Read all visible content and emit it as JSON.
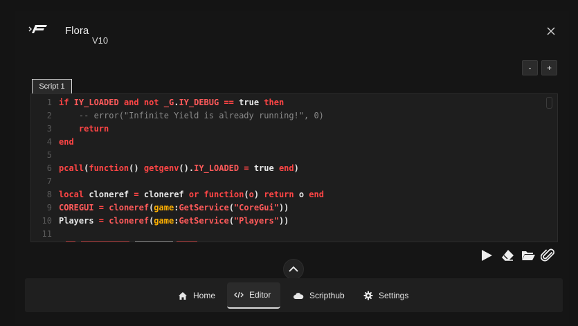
{
  "app": {
    "title": "Flora",
    "version": "V10"
  },
  "zoom": {
    "minus_label": "-",
    "plus_label": "+"
  },
  "editor": {
    "tabs": [
      {
        "label": "Script 1"
      }
    ],
    "lines": [
      {
        "n": "1",
        "tokens": [
          [
            "kw",
            "if "
          ],
          [
            "tk",
            "IY_LOADED"
          ],
          [
            "kw",
            " and not "
          ],
          [
            "tk",
            "_G"
          ],
          [
            "pl",
            "."
          ],
          [
            "tk",
            "IY_DEBUG"
          ],
          [
            "kw",
            " == "
          ],
          [
            "pl",
            "true"
          ],
          [
            "kw",
            " then"
          ]
        ]
      },
      {
        "n": "2",
        "tokens": [
          [
            "cm",
            "    -- error(\"Infinite Yield is already running!\", 0)"
          ]
        ]
      },
      {
        "n": "3",
        "tokens": [
          [
            "kw",
            "    return"
          ]
        ]
      },
      {
        "n": "4",
        "tokens": [
          [
            "kw",
            "end"
          ]
        ]
      },
      {
        "n": "5",
        "tokens": []
      },
      {
        "n": "6",
        "tokens": [
          [
            "kw",
            "pcall"
          ],
          [
            "pl",
            "("
          ],
          [
            "kw",
            "function"
          ],
          [
            "pl",
            "() "
          ],
          [
            "kw",
            "getgenv"
          ],
          [
            "pl",
            "()."
          ],
          [
            "tk",
            "IY_LOADED"
          ],
          [
            "kw",
            " = "
          ],
          [
            "pl",
            "true"
          ],
          [
            "kw",
            " end"
          ],
          [
            "pl",
            ")"
          ]
        ]
      },
      {
        "n": "7",
        "tokens": []
      },
      {
        "n": "8",
        "tokens": [
          [
            "kw",
            "local "
          ],
          [
            "pl",
            "cloneref"
          ],
          [
            "kw",
            " = "
          ],
          [
            "pl",
            "cloneref"
          ],
          [
            "kw",
            " or function"
          ],
          [
            "pl",
            "("
          ],
          [
            "tk",
            "o"
          ],
          [
            "pl",
            ") "
          ],
          [
            "kw",
            "return "
          ],
          [
            "pl",
            "o"
          ],
          [
            "kw",
            " end"
          ]
        ]
      },
      {
        "n": "9",
        "tokens": [
          [
            "tk",
            "COREGUI"
          ],
          [
            "kw",
            " = "
          ],
          [
            "tk",
            "cloneref"
          ],
          [
            "pl",
            "("
          ],
          [
            "gl",
            "game"
          ],
          [
            "pl",
            ":"
          ],
          [
            "tk",
            "GetService"
          ],
          [
            "pl",
            "("
          ],
          [
            "tk",
            "\"CoreGui\""
          ],
          [
            "pl",
            "))"
          ]
        ]
      },
      {
        "n": "10",
        "tokens": [
          [
            "pl",
            "Players"
          ],
          [
            "kw",
            " = "
          ],
          [
            "tk",
            "cloneref"
          ],
          [
            "pl",
            "("
          ],
          [
            "gl",
            "game"
          ],
          [
            "pl",
            ":"
          ],
          [
            "tk",
            "GetService"
          ],
          [
            "pl",
            "("
          ],
          [
            "tk",
            "\"Players\""
          ],
          [
            "pl",
            "))"
          ]
        ]
      },
      {
        "n": "11",
        "tokens": []
      }
    ]
  },
  "actions": [
    {
      "name": "run-icon"
    },
    {
      "name": "eraser-icon"
    },
    {
      "name": "folder-open-icon"
    },
    {
      "name": "paperclip-icon"
    }
  ],
  "nav": {
    "home": "Home",
    "editor": "Editor",
    "scripthub": "Scripthub",
    "settings": "Settings",
    "active": "editor"
  },
  "colors": {
    "keyword": "#ff4545",
    "global": "#ffb000",
    "comment": "#8a8a8a",
    "background": "#151515"
  }
}
